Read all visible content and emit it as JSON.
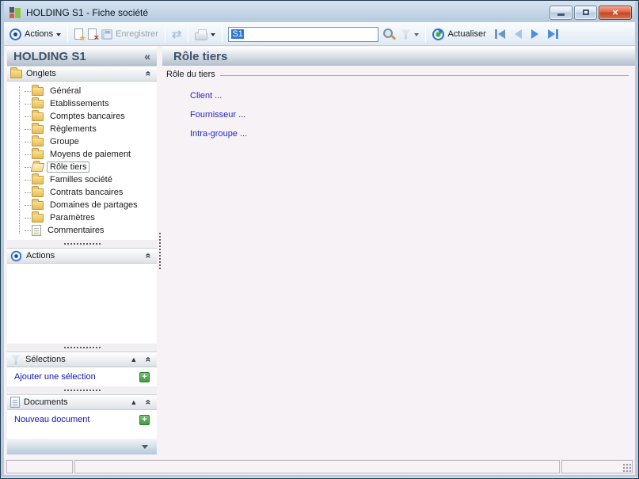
{
  "window": {
    "title": "HOLDING S1 -  Fiche société",
    "controls": {
      "minimize": "minimize",
      "restore": "restore",
      "close_glyph": "×"
    }
  },
  "icons": {
    "chevron_double_up": "«",
    "chevron_single_up": "▲",
    "collapse_left": "«",
    "star": "★",
    "red_x": "×",
    "refresh_arrows": "⇄",
    "plus": "+"
  },
  "toolbar": {
    "actions_label": "Actions",
    "enregistrer_label": "Enregistrer",
    "search": {
      "value": "S1"
    },
    "actualiser_label": "Actualiser"
  },
  "sidebar": {
    "title": "HOLDING S1",
    "onglets": {
      "label": "Onglets",
      "tree": [
        {
          "label": "Général"
        },
        {
          "label": "Etablissements"
        },
        {
          "label": "Comptes bancaires"
        },
        {
          "label": "Règlements"
        },
        {
          "label": "Groupe"
        },
        {
          "label": "Moyens de paiement"
        },
        {
          "label": "Rôle tiers",
          "selected": true
        },
        {
          "label": "Familles société"
        },
        {
          "label": "Contrats bancaires"
        },
        {
          "label": "Domaines de partages"
        },
        {
          "label": "Paramètres"
        },
        {
          "label": "Commentaires",
          "icon": "note"
        }
      ]
    },
    "actions": {
      "label": "Actions"
    },
    "selections": {
      "label": "Sélections",
      "link": "Ajouter une sélection"
    },
    "documents": {
      "label": "Documents",
      "link": "Nouveau document"
    }
  },
  "main": {
    "title": "Rôle tiers",
    "group_label": "Rôle du tiers",
    "links": [
      "Client ...",
      "Fournisseur ...",
      "Intra-groupe ..."
    ]
  },
  "colors": {
    "accent_blue": "#3a6cc8",
    "link_blue": "#2626c8",
    "sidebar_link_blue": "#1414b5",
    "header_text": "#3c5268",
    "close_red": "#c14426",
    "plus_green": "#3f9c3f",
    "selection_blue": "#2e77d0"
  }
}
